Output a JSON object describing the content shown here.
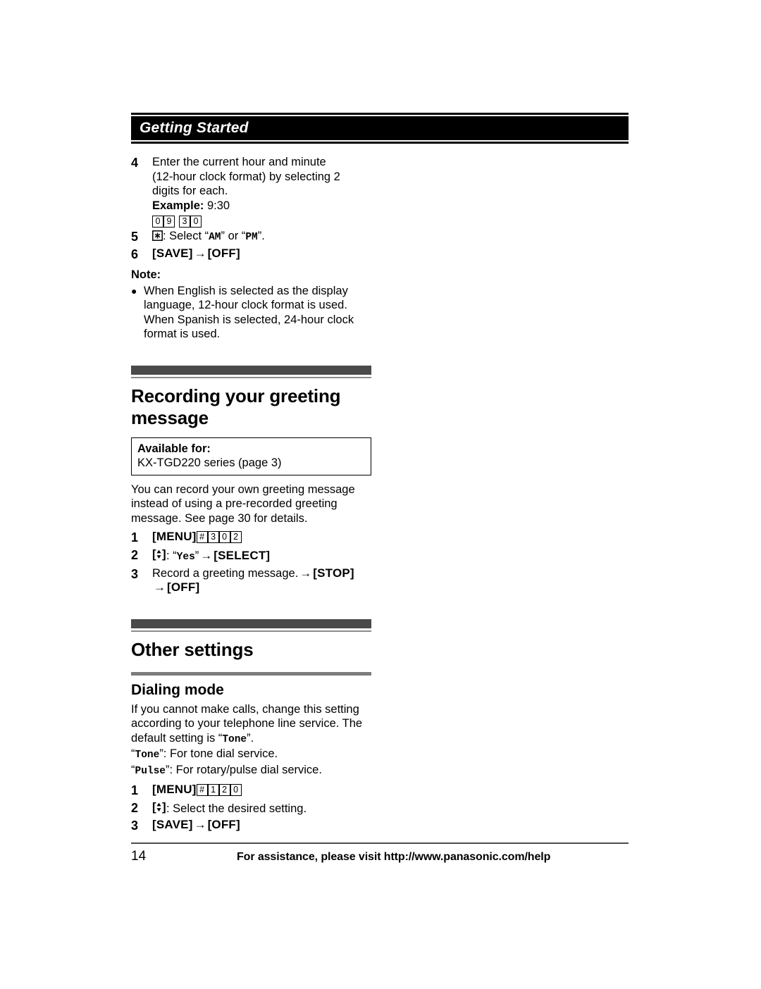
{
  "running_head": {
    "title": "Getting Started"
  },
  "clock_steps": [
    {
      "num": "4",
      "lines": [
        "Enter the current hour and minute",
        "(12-hour clock format) by selecting 2",
        "digits for each."
      ],
      "example_label": "Example:",
      "example_value": "9:30",
      "keys": [
        "0",
        "9",
        "3",
        "0"
      ]
    },
    {
      "num": "5",
      "key_icon": "asterisk-key-icon",
      "text_before": ": Select “",
      "option_a": "AM",
      "text_mid": "” or “",
      "option_b": "PM",
      "text_after": "”."
    },
    {
      "num": "6",
      "key_a": "[SAVE]",
      "arrow": "→",
      "key_b": "[OFF]"
    }
  ],
  "note": {
    "heading": "Note:",
    "bullet_lines": [
      "When English is selected as the display",
      "language, 12-hour clock format is used.",
      "When Spanish is selected, 24-hour clock",
      "format is used."
    ]
  },
  "section_greeting": {
    "title": "Recording your greeting message",
    "available_head": "Available for:",
    "available_text": "KX-TGD220 series (page 3)",
    "intro_lines": [
      "You can record your own greeting message",
      "instead of using a pre-recorded greeting",
      "message. See page 30 for details."
    ],
    "steps": [
      {
        "num": "1",
        "menu_key": "[MENU]",
        "keys": [
          "#",
          "3",
          "0",
          "2"
        ]
      },
      {
        "num": "2",
        "nav_icon": "navigator-up-down-key-icon",
        "text_before": ": “",
        "display_value": "Yes",
        "text_after": "”",
        "arrow": "→",
        "key_b": "[SELECT]"
      },
      {
        "num": "3",
        "text": "Record a greeting message.",
        "arrow": "→",
        "key_b": "[STOP]",
        "arrow2": "→",
        "key_c": "[OFF]"
      }
    ]
  },
  "section_other": {
    "title": "Other settings",
    "subsection": {
      "title": "Dialing mode",
      "intro_lines": [
        "If you cannot make calls, change this setting",
        "according to your telephone line service. The"
      ],
      "default_prefix": "default setting is “",
      "default_value": "Tone",
      "default_suffix": "”.",
      "tone_value": "Tone",
      "tone_desc": "”: For tone dial service.",
      "pulse_value": "Pulse",
      "pulse_desc": "”: For rotary/pulse dial service.",
      "quote_open": "“",
      "steps": [
        {
          "num": "1",
          "menu_key": "[MENU]",
          "keys": [
            "#",
            "1",
            "2",
            "0"
          ]
        },
        {
          "num": "2",
          "nav_icon": "navigator-up-down-key-icon",
          "text": ": Select the desired setting."
        },
        {
          "num": "3",
          "key_a": "[SAVE]",
          "arrow": "→",
          "key_b": "[OFF]"
        }
      ]
    }
  },
  "footer": {
    "page_number": "14",
    "assistance": "For assistance, please visit http://www.panasonic.com/help"
  },
  "colors": {
    "runhead_bg": "#000000",
    "section_bar": "#4a4a4a",
    "sub_rule": "#7d7d7d",
    "footer_rule": "#4d4d4d"
  }
}
